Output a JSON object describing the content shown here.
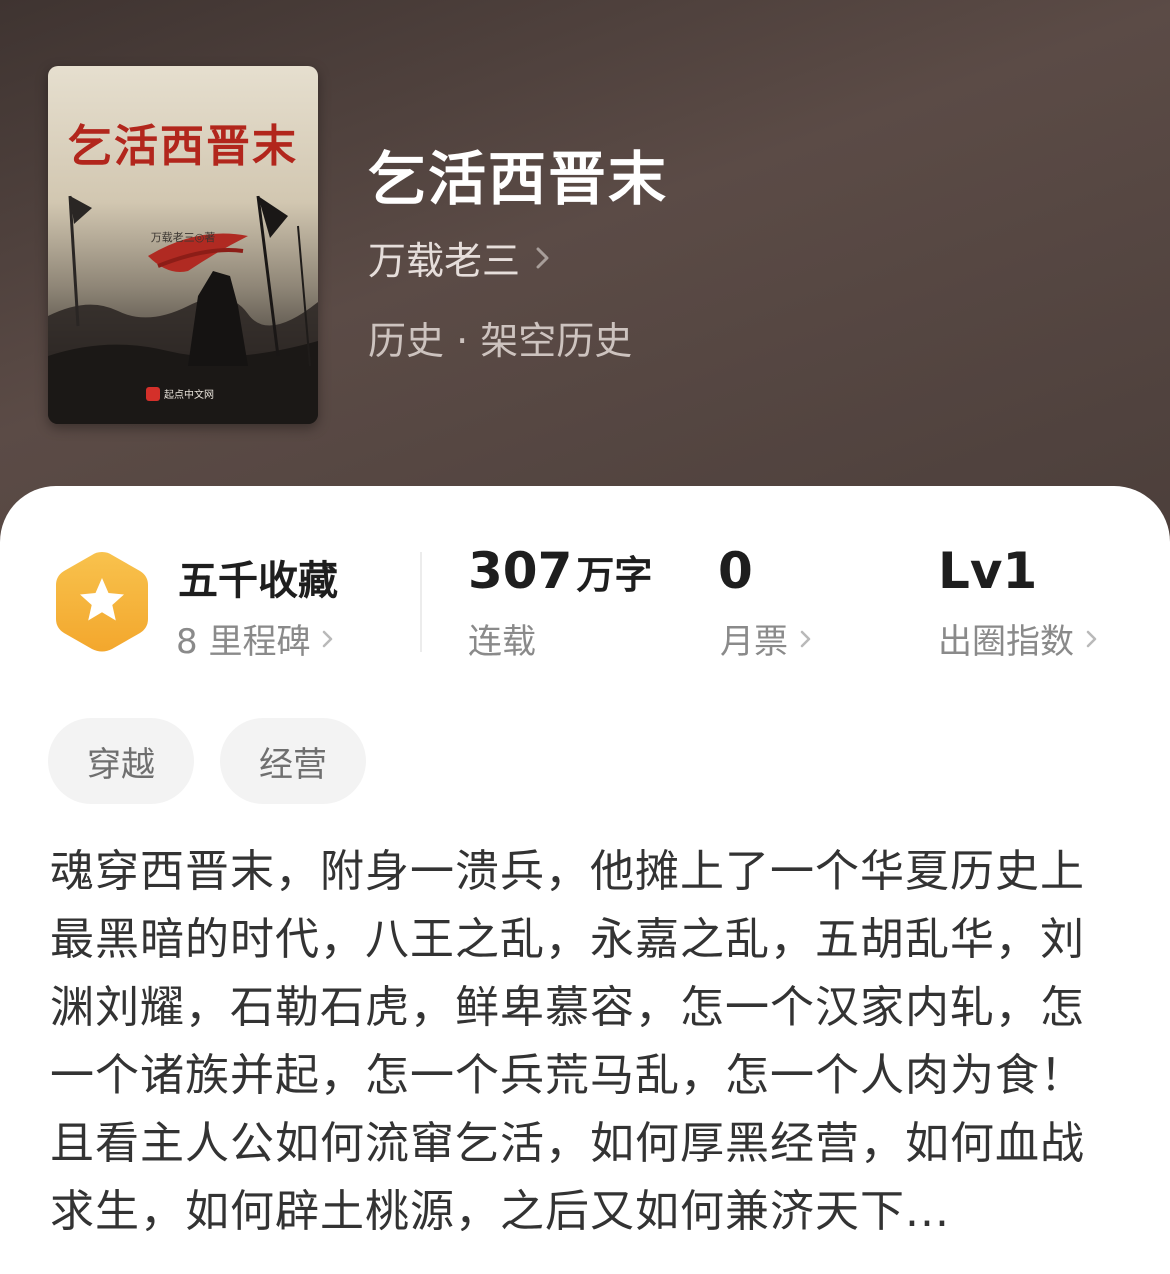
{
  "book": {
    "cover_title": "乞活西晋末",
    "cover_author": "万载老三◎著",
    "cover_publisher": "起点中文网",
    "title": "乞活西晋末",
    "author": "万载老三",
    "genre": "历史 · 架空历史"
  },
  "stats": {
    "milestone": {
      "title": "五千收藏",
      "sub": "8 里程碑",
      "icon": "star-hexagon-icon",
      "color": "#f6b23c"
    },
    "words": {
      "value": "307",
      "unit": "万字",
      "label": "连载"
    },
    "monthly_ticket": {
      "value": "0",
      "label": "月票"
    },
    "breakout": {
      "value": "Lv1",
      "label": "出圈指数"
    }
  },
  "tags": [
    "穿越",
    "经营"
  ],
  "synopsis": "魂穿西晋末，附身一溃兵，他摊上了一个华夏历史上最黑暗的时代，八王之乱，永嘉之乱，五胡乱华，刘渊刘耀，石勒石虎，鲜卑慕容，怎一个汉家内轧，怎一个诸族并起，怎一个兵荒马乱，怎一个人肉为食！且看主人公如何流窜乞活，如何厚黑经营，如何血战求生，如何辟土桃源，之后又如何兼济天下..."
}
